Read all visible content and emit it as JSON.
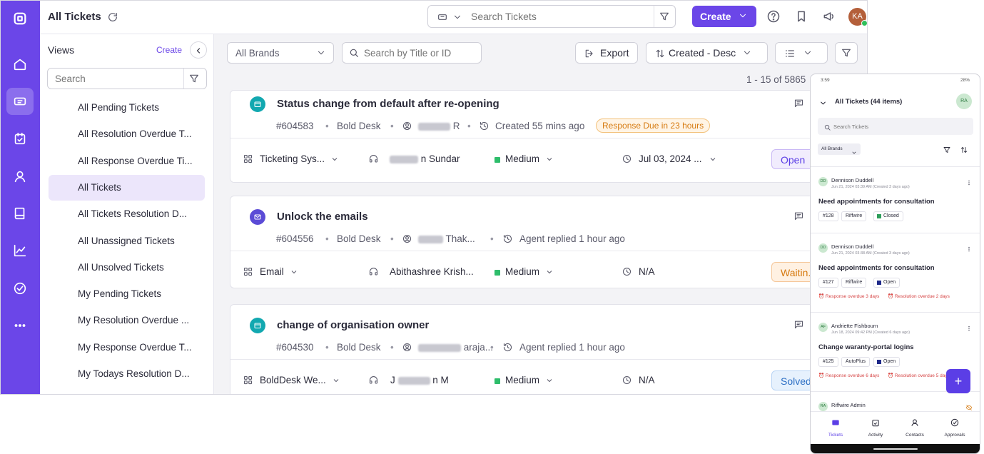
{
  "topbar": {
    "title": "All Tickets",
    "search_placeholder": "Search Tickets",
    "create_label": "Create",
    "avatar_initials": "KA"
  },
  "views": {
    "heading": "Views",
    "create_label": "Create",
    "search_placeholder": "Search",
    "items": [
      "All Pending Tickets",
      "All Resolution Overdue T...",
      "All Response Overdue Ti...",
      "All Tickets",
      "All Tickets Resolution D...",
      "All Unassigned Tickets",
      "All Unsolved Tickets",
      "My Pending Tickets",
      "My Resolution Overdue ...",
      "My Response Overdue T...",
      "My Todays Resolution D..."
    ],
    "selected_index": 3
  },
  "toolbar": {
    "brands_label": "All Brands",
    "search_placeholder": "Search by Title or ID",
    "export_label": "Export",
    "sort_label": "Created - Desc",
    "pagination": "1 - 15 of 5865"
  },
  "tickets": [
    {
      "title": "Status change from default after re-opening",
      "id": "#604583",
      "brand": "Bold Desk",
      "contact_suffix": "R",
      "time": "Created 55 mins ago",
      "badge": "Response Due in 23 hours",
      "category": "Ticketing Sys...",
      "agent": "n Sundar",
      "priority": "Medium",
      "due": "Jul 03, 2024 ...",
      "status": "Open",
      "icon_color": "#12a8b0"
    },
    {
      "title": "Unlock the emails",
      "id": "#604556",
      "brand": "Bold Desk",
      "contact_suffix": "Thak...",
      "time": "Agent replied 1 hour ago",
      "badge": "",
      "category": "Email",
      "agent": "Abithashree Krish...",
      "priority": "Medium",
      "due": "N/A",
      "status": "Waitin...",
      "icon_color": "#5b4bd6"
    },
    {
      "title": "change of organisation owner",
      "id": "#604530",
      "brand": "Bold Desk",
      "contact_suffix": "araja...",
      "time": "Agent replied 1 hour ago",
      "badge": "",
      "category": "BoldDesk We...",
      "agent_prefix": "J",
      "agent": "n M",
      "priority": "Medium",
      "due": "N/A",
      "status": "Solved",
      "icon_color": "#12a8b0"
    }
  ],
  "phone": {
    "status_time": "3:59",
    "battery": "28%",
    "header_title": "All Tickets (44 items)",
    "avatar_initials": "RA",
    "search_placeholder": "Search Tickets",
    "brands_label": "All Brands",
    "cards": [
      {
        "initials": "DD",
        "name": "Dennison Duddell",
        "date": "Jun 21, 2024 03:39 AM (Created 3 days ago)",
        "title": "Need appointments for consultation",
        "id": "#128",
        "brand": "Riffwire",
        "status": "Closed",
        "status_color": "#2e9e5b",
        "overdue": [
          "",
          ""
        ]
      },
      {
        "initials": "DD",
        "name": "Dennison Duddell",
        "date": "Jun 21, 2024 03:38 AM (Created 3 days ago)",
        "title": "Need appointments for consultation",
        "id": "#127",
        "brand": "Riffwire",
        "status": "Open",
        "status_color": "#1f2a8a",
        "overdue": [
          "Response overdue 3 days",
          "Resolution overdue 2 days"
        ]
      },
      {
        "initials": "AF",
        "name": "Andriette Fishbourn",
        "date": "Jun 18, 2024 09:42 PM (Created 6 days ago)",
        "title": "Change waranty-portal logins",
        "id": "#125",
        "brand": "AutoPlus",
        "status": "Open",
        "status_color": "#1f2a8a",
        "overdue": [
          "Response overdue 6 days",
          "Resolution overdue 5 days"
        ]
      },
      {
        "initials": "RA",
        "name": "Riffwire Admin",
        "date": "",
        "title": "",
        "id": "",
        "brand": "",
        "status": "",
        "status_color": "",
        "overdue": [
          "",
          ""
        ]
      }
    ],
    "nav": [
      "Tickets",
      "Activity",
      "Contacts",
      "Approvals"
    ],
    "fab": "+"
  },
  "colors": {
    "brand": "#6b46e8",
    "selected_view": "#ece6fb",
    "badge_bg": "#fff4e5",
    "badge_text": "#d67a10"
  }
}
